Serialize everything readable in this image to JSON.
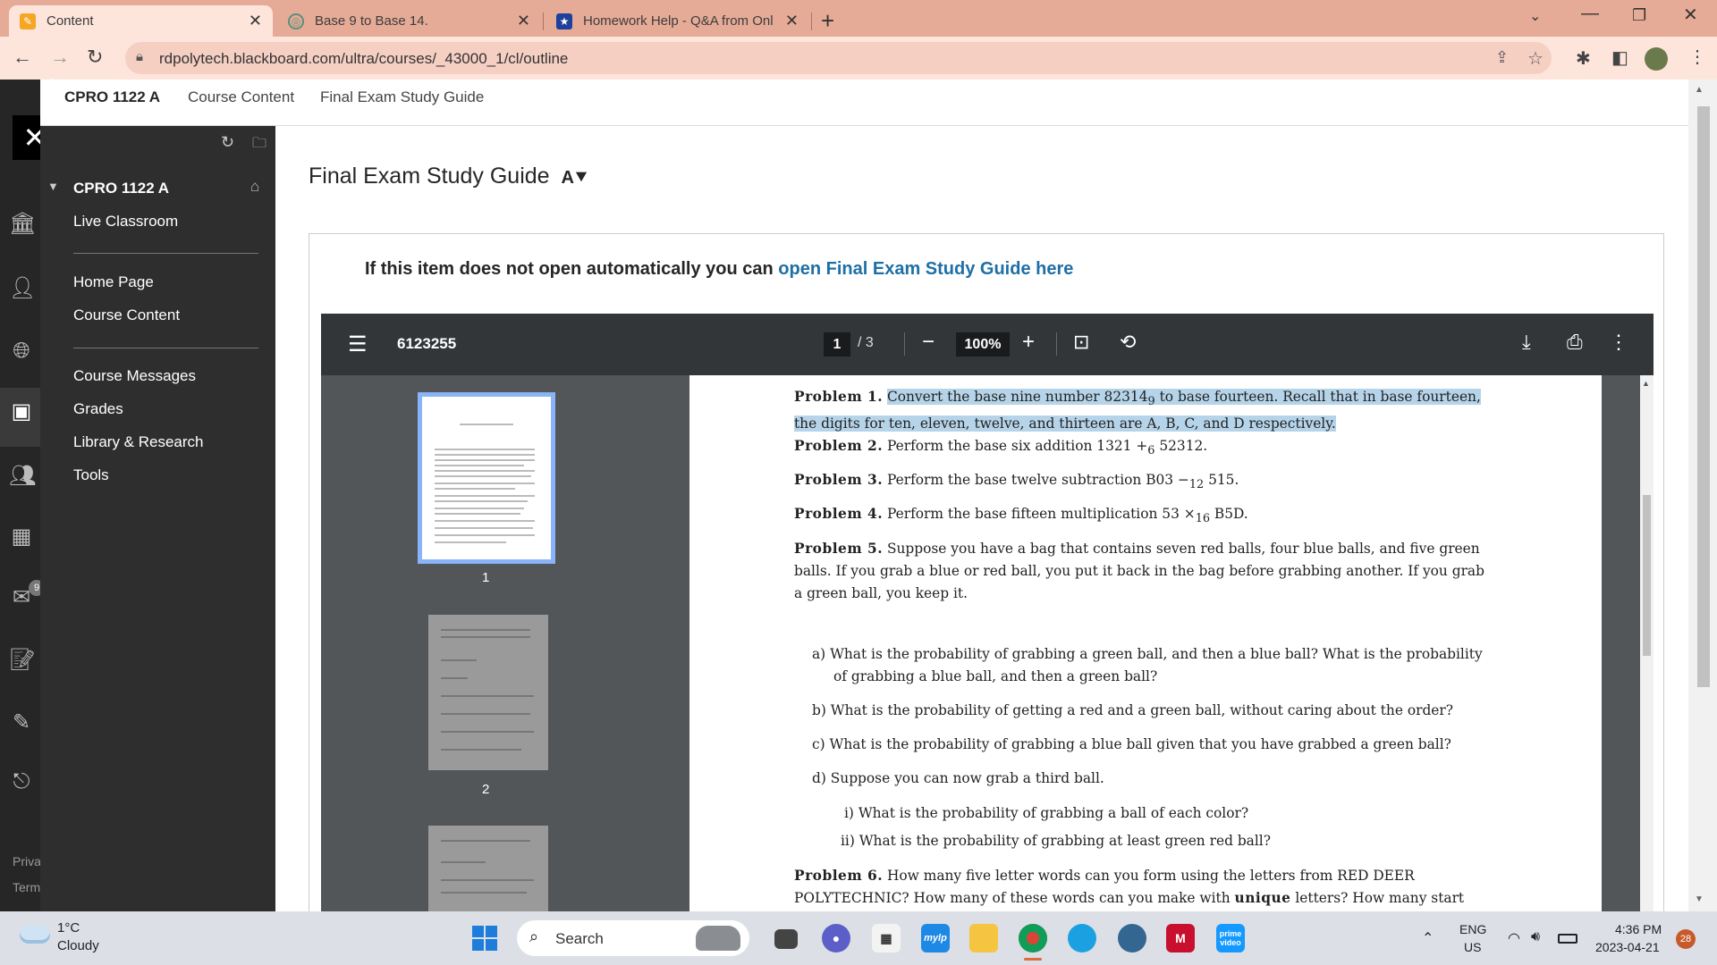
{
  "tabs": [
    {
      "title": "Content",
      "active": true
    },
    {
      "title": "Base 9 to Base 14.",
      "active": false
    },
    {
      "title": "Homework Help - Q&A from Onl",
      "active": false
    }
  ],
  "url": "rdpolytech.blackboard.com/ultra/courses/_43000_1/cl/outline",
  "header": {
    "course": "CPRO 1122 A",
    "crumb1": "Course Content",
    "crumb2": "Final Exam Study Guide"
  },
  "menu": {
    "course": "CPRO 1122 A",
    "items1": [
      "Live Classroom"
    ],
    "items2": [
      "Home Page",
      "Course Content"
    ],
    "items3": [
      "Course Messages",
      "Grades",
      "Library & Research",
      "Tools"
    ]
  },
  "rail_footer": {
    "privacy": "Priva",
    "terms": "Term",
    "badge": "9"
  },
  "page_title": "Final Exam Study Guide",
  "open_msg": {
    "prefix": "If this item does not open automatically you can ",
    "link": "open Final Exam Study Guide here"
  },
  "pdf": {
    "doc_title": "6123255",
    "page": "1",
    "pages": "/ 3",
    "zoom": "100%",
    "thumbs": [
      "1",
      "2"
    ],
    "p1_label": "Problem 1.",
    "p1_text": "Convert the base nine number 82314",
    "p1_sub": "9",
    "p1_text2": " to base fourteen. Recall that in base fourteen, the digits for ten, eleven, twelve, and thirteen are A, B, C, and D respectively.",
    "p2_label": "Problem 2.",
    "p2_text": "Perform the base six addition 1321 +",
    "p2_sub": "6",
    "p2_text2": " 52312.",
    "p3_label": "Problem 3.",
    "p3_text": "Perform the base twelve subtraction B03 −",
    "p3_sub": "12",
    "p3_text2": " 515.",
    "p4_label": "Problem 4.",
    "p4_text": "Perform the base fifteen multiplication 53 ×",
    "p4_sub": "16",
    "p4_text2": " B5D.",
    "p5_label": "Problem 5.",
    "p5_text": "Suppose you have a bag that contains seven red balls, four blue balls, and five green balls. If you grab a blue or red ball, you put it back in the bag before grabbing another. If you grab a green ball, you keep it.",
    "p5a": "a)  What is the probability of grabbing a green ball, and then a blue ball? What is the probability of grabbing a blue ball, and then a green ball?",
    "p5b": "b)  What is the probability of getting a red and a green ball, without caring about the order?",
    "p5c": "c)  What is the probability of grabbing a blue ball given that you have grabbed a green ball?",
    "p5d": "d)  Suppose you can now grab a third ball.",
    "p5di": "i)  What is the probability of grabbing a ball of each color?",
    "p5dii": "ii)  What is the probability of grabbing at least green red ball?",
    "p6_label": "Problem 6.",
    "p6_text": "How many five letter words can you form using the letters from RED DEER POLYTECHNIC? How many of these words can you make with ",
    "p6_bold": "unique",
    "p6_text2": " letters? How many start with ’DE’?"
  },
  "taskbar": {
    "weather_temp": "1°C",
    "weather_desc": "Cloudy",
    "search": "Search",
    "lang1": "ENG",
    "lang2": "US",
    "time": "4:36 PM",
    "date": "2023-04-21",
    "notif": "28",
    "mylp": "mylp",
    "prime": "prime video"
  },
  "colors": {
    "tabstrip": "#e6ab97",
    "toolbar": "#fde5dc",
    "rail": "#262626",
    "menu": "#2e2e2e",
    "link": "#1d6fa5",
    "pdfbar": "#323639",
    "pdfbg": "#525659",
    "highlight": "#b6d4e9"
  }
}
